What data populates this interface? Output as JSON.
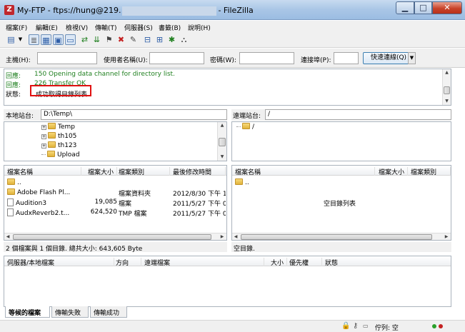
{
  "window": {
    "title_prefix": "My-FTP - ftps://hung@219.",
    "title_suffix": "- FileZilla",
    "app_icon": "Z"
  },
  "menu": [
    "檔案(F)",
    "編輯(E)",
    "檢視(V)",
    "傳輸(T)",
    "伺服器(S)",
    "書籤(B)",
    "說明(H)"
  ],
  "quickconnect": {
    "host_label": "主機(H):",
    "host_value": "",
    "user_label": "使用者名稱(U):",
    "user_value": "",
    "pass_label": "密碼(W):",
    "pass_value": "",
    "port_label": "連接埠(P):",
    "port_value": "",
    "connect_button": "快速連線(Q)"
  },
  "log": [
    {
      "kind": "回應:",
      "text": "150 Opening data channel for directory list.",
      "color": "#1e7f1e"
    },
    {
      "kind": "回應:",
      "text": "226 Transfer OK",
      "color": "#1e7f1e"
    },
    {
      "kind": "狀態:",
      "text": "成功取得目錄列表",
      "color": "#000000"
    }
  ],
  "local": {
    "site_label": "本地站台:",
    "path": "D:\\Temp\\",
    "tree": [
      "Temp",
      "th105",
      "th123",
      "Upload"
    ],
    "columns": [
      "檔案名稱",
      "檔案大小",
      "檔案類別",
      "最後修改時間"
    ],
    "rows": [
      {
        "name": "..",
        "size": "",
        "type": "",
        "modified": ""
      },
      {
        "name": "Adobe Flash Pl...",
        "size": "",
        "type": "檔案資料夾",
        "modified": "2012/8/30 下午 1."
      },
      {
        "name": "Audition3",
        "size": "19,085",
        "type": "檔案",
        "modified": "2011/5/27 下午 0."
      },
      {
        "name": "AudxReverb2.t...",
        "size": "624,520",
        "type": "TMP 檔案",
        "modified": "2011/5/27 下午 0."
      }
    ],
    "status": "2 個檔案與 1 個目錄. 總共大小: 643,605 Byte"
  },
  "remote": {
    "site_label": "遠端站台:",
    "path": "/",
    "tree": [
      "/"
    ],
    "columns": [
      "檔案名稱",
      "檔案大小",
      "檔案類別"
    ],
    "rows": [
      {
        "name": ".."
      }
    ],
    "empty_text": "空目錄列表",
    "status": "空目錄."
  },
  "queue": {
    "columns": [
      "伺服器/本地檔案",
      "方向",
      "遠端檔案",
      "大小",
      "優先權",
      "狀態"
    ]
  },
  "tabs": [
    "等候的檔案",
    "傳輸失敗",
    "傳輸成功"
  ],
  "statusbar": {
    "queue_text": "佇列: 空"
  },
  "colors": {
    "accent": "#c0282d",
    "log_green": "#1e7f1e",
    "highlight": "#e01010",
    "led_green": "#2aa02a",
    "led_red": "#c42121"
  }
}
